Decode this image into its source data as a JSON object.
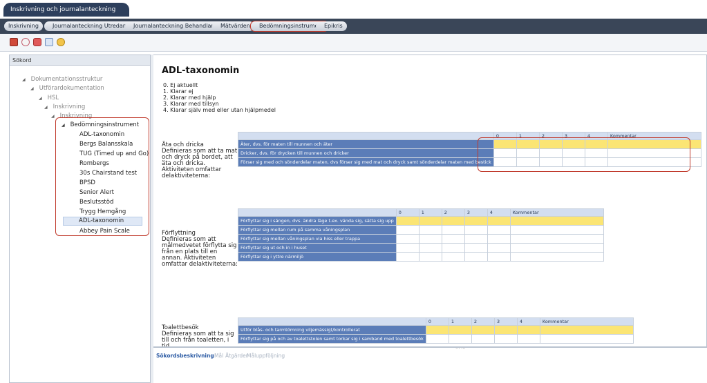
{
  "app": {
    "title": "Inskrivning och journalanteckning"
  },
  "breadcrumbs": [
    "Inskrivning",
    "Journalanteckning Utredande",
    "Journalanteckning Behandlande",
    "Mätvärden",
    "Bedömningsinstrument",
    "Epikris"
  ],
  "left_panel": {
    "header": "Sökord",
    "tree": {
      "root": "Dokumentationsstruktur",
      "level1": "Utförardokumentation",
      "level2": "HSL",
      "level3": "Inskrivning",
      "level4": "Inskrivning"
    },
    "instruments_header": "Bedömningsinstrument",
    "instruments": [
      "ADL-taxonomin",
      "Bergs Balansskala",
      "TUG (Timed up and Go)",
      "Rombergs",
      "30s Chairstand test",
      "BPSD",
      "Senior Alert",
      "Beslutsstöd",
      "Trygg Hemgång",
      "ADL-taxonomin",
      "Abbey Pain Scale"
    ]
  },
  "main": {
    "title": "ADL-taxonomin",
    "legend": [
      "0. Ej aktuellt",
      "1. Klarar ej",
      "2. Klarar med hjälp",
      "3. Klarar med tillsyn",
      "4. Klarar själv med eller utan hjälpmedel"
    ],
    "scale_headers": [
      "0",
      "1",
      "2",
      "3",
      "4",
      "Kommentar"
    ],
    "sections": [
      {
        "label": "Äta och dricka\nDefinieras som att ta mat och dryck på bordet, att äta och dricka. Aktiviteten omfattar delaktiviteterna:",
        "rows": [
          "Äter, dvs. för maten till munnen och äter",
          "Dricker, dvs. för drycken till munnen och dricker",
          "Förser sig med och sönderdelar maten, dvs förser sig med mat och dryck samt sönderdelar maten med bestick"
        ]
      },
      {
        "label": "Förflyttning\nDefinieras som att målmedvetet förflytta sig från en plats till en annan. Aktiviteten omfattar delaktiviteterna:",
        "rows": [
          "Förflyttar sig i sängen, dvs. ändra läge t.ex. vända sig, sätta sig upp",
          "Förflyttar sig mellan rum på samma våningsplan",
          "Förflyttar sig mellan våningsplan via hiss eller trappa",
          "Förflyttar sig ut och in i huset",
          "Förflyttar sig i yttre närmiljö"
        ]
      },
      {
        "label": "Toalettbesök\nDefinieras som att ta sig till och från toaletten, i tid,",
        "rows": [
          "Utför blås- och tarmtömning viljemässigt/kontrollerat",
          "Förflyttar sig på och av toalettstolen samt torkar sig i samband med toalettbesök"
        ]
      }
    ]
  },
  "bottom_tabs": [
    "Sökordsbeskrivning",
    "Mål",
    "Åtgärder",
    "Måluppföljning"
  ],
  "colors": {
    "nav_bg": "#3a4658",
    "highlight_red": "#c0392b",
    "selected_row": "#fbe574",
    "activity_cell": "#5b7db8"
  }
}
